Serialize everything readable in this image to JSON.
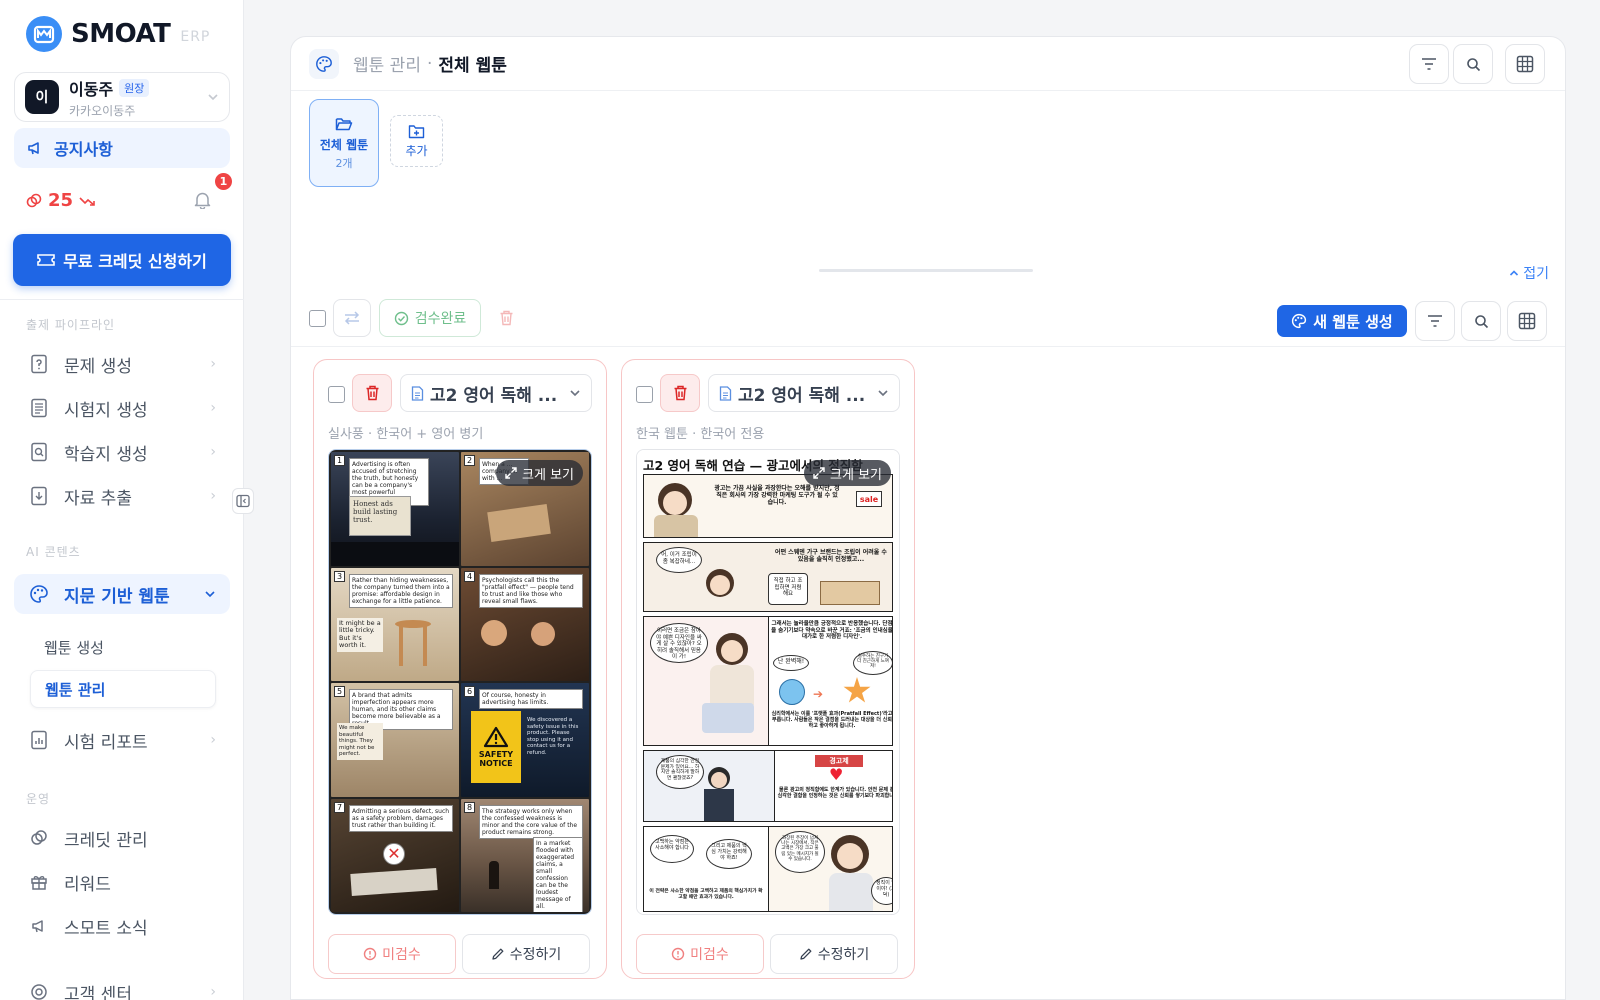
{
  "brand": {
    "name": "SMOAT",
    "sub": "ERP"
  },
  "user": {
    "initial": "이",
    "name": "이동주",
    "role": "원장",
    "org": "카카오이동주"
  },
  "sidebar": {
    "notice": "공지사항",
    "credit": "25",
    "notifications": "1",
    "free_credit": "무료 크레딧 신청하기",
    "sections": {
      "pipeline": "출제 파이프라인",
      "ai": "AI 콘텐츠",
      "ops": "운영"
    },
    "items": {
      "question": "문제 생성",
      "exam": "시험지 생성",
      "worksheet": "학습지 생성",
      "extract": "자료 추출",
      "webtoon": "지문 기반 웹툰",
      "webtoon_create": "웹툰 생성",
      "webtoon_manage": "웹툰 관리",
      "report": "시험 리포트",
      "credit_manage": "크레딧 관리",
      "reward": "리워드",
      "news": "스모트 소식",
      "support": "고객 센터"
    }
  },
  "header": {
    "prev": "웹툰 관리",
    "sep": "·",
    "current": "전체 웹툰"
  },
  "folders": {
    "all_title": "전체 웹툰",
    "all_count": "2개",
    "add": "추가",
    "collapse": "접기"
  },
  "toolbar": {
    "approve": "검수완료",
    "new_webtoon": "새 웹툰 생성"
  },
  "cards": [
    {
      "title": "고2 영어 독해 ...",
      "meta": "실사풍 · 한국어 + 영어 병기",
      "enlarge": "크게 보기",
      "pending": "미검수",
      "edit": "수정하기",
      "panels": [
        {
          "n": "1",
          "cap": "Advertising is often accused of stretching the truth, but honesty can be a company's most powerful marketing tool.",
          "sign": "Honest ads build lasting trust.",
          "bg": "#2b3342"
        },
        {
          "n": "2",
          "cap": "When a ... company ... with ...",
          "bg": "#8a6a4a"
        },
        {
          "n": "3",
          "cap": "Rather than hiding weaknesses, the company turned them into a promise: affordable design in exchange for a little patience.",
          "sign": "It might be a little tricky. But it's worth it.",
          "bg": "#d8cbb4"
        },
        {
          "n": "4",
          "cap": "Psychologists call this the \"pratfall effect\" — people tend to trust and like those who reveal small flaws.",
          "bg": "#5a3e2c"
        },
        {
          "n": "5",
          "cap": "A brand that admits imperfection appears more human, and its other claims become more believable as a result.",
          "sign": "We make beautiful things. They might not be perfect.",
          "bg": "#cdb89c"
        },
        {
          "n": "6",
          "cap": "Of course, honesty in advertising has limits.",
          "sign": "SAFETY NOTICE",
          "extra": "We discovered a safety issue in this product. Please stop using it and contact us for a refund.",
          "bg": "#1f2f45"
        },
        {
          "n": "7",
          "cap": "Admitting a serious defect, such as a safety problem, damages trust rather than building it.",
          "bg": "#3b3026"
        },
        {
          "n": "8",
          "cap": "The strategy works only when the confessed weakness is minor and the core value of the product remains strong.",
          "extra": "In a market flooded with exaggerated claims, a small confession can be the loudest message of all.",
          "bg": "#6d5a48"
        }
      ]
    },
    {
      "title": "고2 영어 독해 ...",
      "meta": "한국 웹툰 · 한국어 전용",
      "enlarge": "크게 보기",
      "pending": "미검수",
      "edit": "수정하기",
      "comic_title": "고2 영어 독해 연습 — 광고에서의 정직함",
      "texts": {
        "r1": "광고는 가끔 사실을 과장한다는 오해를 받지만, 정직은 회사의 가장 강력한 마케팅 도구가 될 수 있습니다.",
        "sale": "sale",
        "r2b": "어떤 스웨덴 가구 브랜드는 조립이 어려울 수 있음을 솔직히 인정했고...",
        "r2a": "어, 이거 조립이 좀 복잡하네...",
        "r2c": "직접 하고 조립하면 저렴해요",
        "r3a": "이러면 조금은 참아야 예쁜 디자인을 싸게 살 수 있잖아? 오히려 솔직해서 믿음이 가!",
        "r3b": "그래서는 놀라울만큼 긍정적으로 반응했습니다. 단점을 숨기기보다 약속으로 바꾼 거죠: '조금의 인내심을 대가로 한 저렴한 디자인'.",
        "r3c": "난 완벽해!",
        "r3d": "실수하는 친구가 더 친근하게 느껴져!",
        "r3e": "심리학에서는 이를 '프랫폴 효과(Pratfall Effect)'라고 부릅니다. 사람들은 작은 결점을 드러내는 대상을 더 신뢰하고 좋아하게 됩니다.",
        "r4a": "제품의 심각한 안전 문제가 있어요... 하지만 솔직하게 말하면 괜찮겠죠?",
        "r4b": "경고제",
        "r4c": "물론 광고의 정직함에도 한계가 있습니다. 안전 문제 같은 심각한 결함을 인정하는 것은 신뢰를 쌓기보다 파괴합니다.",
        "r5a": "고백하는 약점은 사소해야 합니다",
        "r5b": "그리고 제품의 핵심 가치는 강력해야 하죠!",
        "r5c": "과장된 주장이 넘쳐나는 시장에서, 작은 고백은 가장 크고 울림 있는 메시지가 될 수 있습니다.",
        "r5d": "정직이 답이야! (끄덕)",
        "r5e": "이 전략은 사소한 약점을 고백하고 제품의 핵심가치가 확고할 때만 효과가 있습니다."
      }
    }
  ]
}
